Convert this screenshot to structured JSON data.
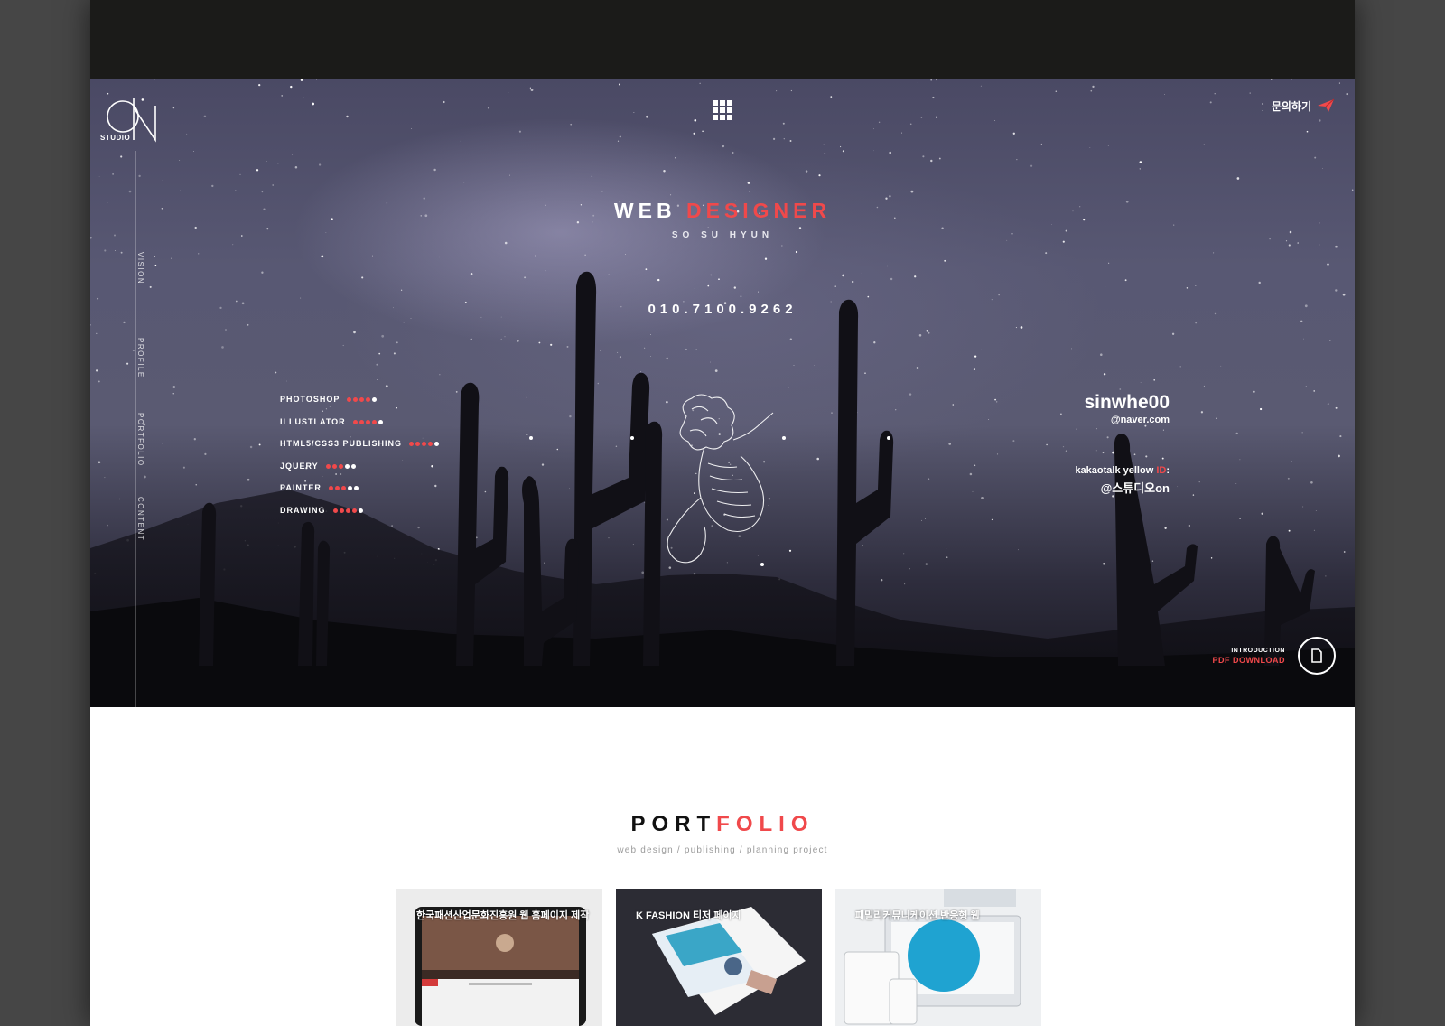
{
  "header": {
    "logo_letters": "ON",
    "logo_text": "STUDIO",
    "contact_label": "문의하기"
  },
  "side_nav": {
    "items": [
      {
        "label": "VISION"
      },
      {
        "label": "PROFILE"
      },
      {
        "label": "PORTFOLIO"
      },
      {
        "label": "CONTENT"
      }
    ]
  },
  "hero": {
    "title_part1": "WEB",
    "title_part2": "DESIGNER",
    "subtitle": "SO SU HYUN",
    "phone": "010.7100.9262",
    "accent_color": "#f0494b"
  },
  "skills": [
    {
      "name": "PHOTOSHOP",
      "level": 4,
      "max": 5
    },
    {
      "name": "ILLUSTLATOR",
      "level": 4,
      "max": 5
    },
    {
      "name": "HTML5/CSS3 PUBLISHING",
      "level": 4,
      "max": 5
    },
    {
      "name": "JQUERY",
      "level": 3,
      "max": 5
    },
    {
      "name": "PAINTER",
      "level": 3,
      "max": 5
    },
    {
      "name": "DRAWING",
      "level": 4,
      "max": 5
    }
  ],
  "contact_info": {
    "email_user": "sinwhe00",
    "email_domain": "@naver.com",
    "kakao_label_prefix": "kakaotalk yellow ",
    "kakao_label_accent": "ID",
    "kakao_label_suffix": ":",
    "kakao_id": "@스튜디오on"
  },
  "pdf": {
    "small_label": "INTRODUCTION",
    "download_label": "PDF DOWNLOAD"
  },
  "portfolio": {
    "title_part1": "PORT",
    "title_part2": "FOLIO",
    "subtitle": "web design / publishing / planning project",
    "cards": [
      {
        "label": "한국패션산업문화진흥원 웹 홈페이지 제작"
      },
      {
        "label": "K FASHION 티저 페이지"
      },
      {
        "label": "패밀리커뮤니케이션 반응형 웹"
      }
    ]
  }
}
